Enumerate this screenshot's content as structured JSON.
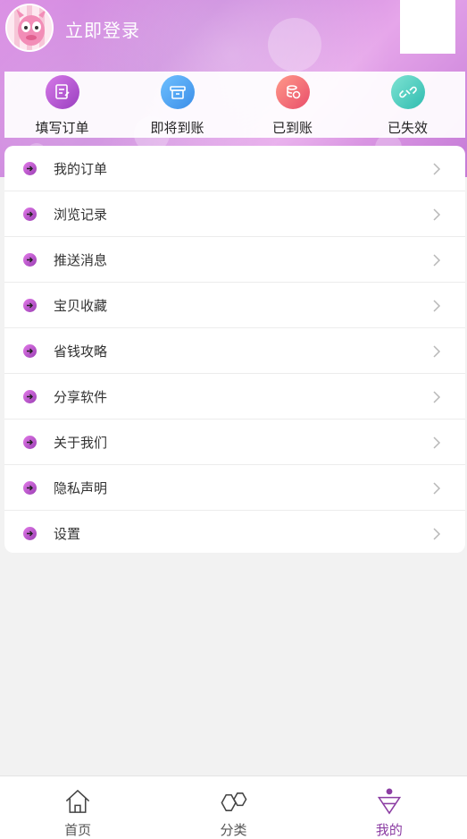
{
  "header": {
    "login_text": "立即登录"
  },
  "status": [
    {
      "label": "填写订单",
      "icon": "edit-order-icon",
      "color": "#b44fd0"
    },
    {
      "label": "即将到账",
      "icon": "pending-icon",
      "color": "#4ea4f2"
    },
    {
      "label": "已到账",
      "icon": "coins-icon",
      "color": "#f26f7a"
    },
    {
      "label": "已失效",
      "icon": "broken-link-icon",
      "color": "#4ed1c4"
    }
  ],
  "menu": [
    {
      "label": "我的订单"
    },
    {
      "label": "浏览记录"
    },
    {
      "label": "推送消息"
    },
    {
      "label": "宝贝收藏"
    },
    {
      "label": "省钱攻略"
    },
    {
      "label": "分享软件"
    },
    {
      "label": "关于我们"
    },
    {
      "label": "隐私声明"
    },
    {
      "label": "设置"
    }
  ],
  "tabbar": [
    {
      "label": "首页",
      "icon": "home-icon",
      "active": false
    },
    {
      "label": "分类",
      "icon": "category-icon",
      "active": false
    },
    {
      "label": "我的",
      "icon": "profile-icon",
      "active": true
    }
  ],
  "colors": {
    "accent": "#8c3ea3",
    "header": "#d08ade"
  }
}
